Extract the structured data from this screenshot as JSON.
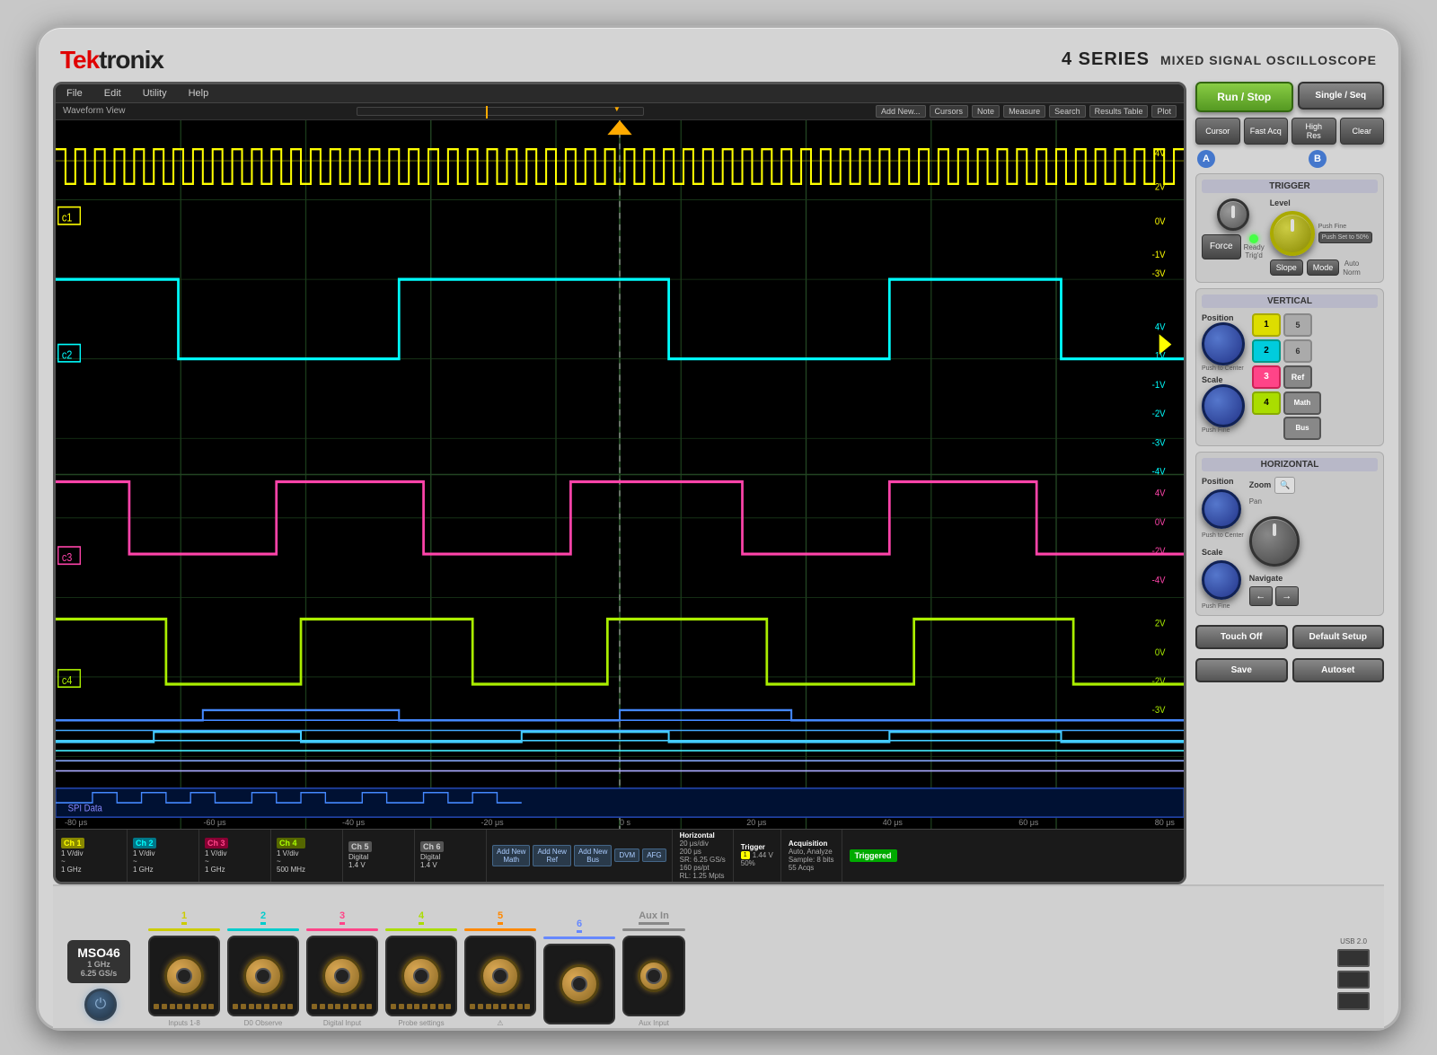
{
  "brand": {
    "name_tek": "Tek",
    "name_tronix": "tronix",
    "series": "4 SERIES",
    "subtitle": "MIXED SIGNAL OSCILLOSCOPE"
  },
  "menu": {
    "items": [
      "File",
      "Edit",
      "Utility",
      "Help"
    ]
  },
  "toolbar": {
    "waveform_view": "Waveform View",
    "add_new": "Add New...",
    "cursors": "Cursors",
    "note": "Note",
    "measure": "Measure",
    "search": "Search",
    "results_table": "Results Table",
    "plot": "Plot"
  },
  "controls": {
    "run_stop": "Run / Stop",
    "single_seq": "Single / Seq",
    "cursor": "Cursor",
    "fast_acq": "Fast Acq",
    "high_res": "High Res",
    "clear": "Clear"
  },
  "trigger": {
    "title": "TRIGGER",
    "force": "Force",
    "ready": "Ready",
    "trig_d": "Trig'd",
    "level_label": "Level",
    "set_50": "Push Set to 50%",
    "slope": "Slope",
    "mode": "Mode",
    "auto": "Auto",
    "norm": "Norm"
  },
  "vertical": {
    "title": "VERTICAL",
    "position_label": "Position",
    "push_to_center": "Push to Center",
    "scale_label": "Scale",
    "push_fine": "Push Fine",
    "ch1": "1",
    "ch2": "2",
    "ch3": "3",
    "ch4": "4",
    "ch5": "5",
    "ch6": "6",
    "ref": "Ref",
    "math": "Math",
    "bus": "Bus"
  },
  "horizontal": {
    "title": "HORIZONTAL",
    "position_label": "Position",
    "zoom_label": "Zoom",
    "pan_label": "Pan",
    "scale_label": "Scale",
    "navigate_label": "Navigate",
    "push_to_center": "Push to Center",
    "push_fine": "Push Fine"
  },
  "bottom_controls": {
    "touch_off": "Touch Off",
    "default_setup": "Default Setup",
    "save": "Save",
    "autoset": "Autoset"
  },
  "status_bar": {
    "ch1_label": "Ch 1",
    "ch1_val1": "1 V/div",
    "ch1_val2": "~",
    "ch1_val3": "1 GHz",
    "ch2_label": "Ch 2",
    "ch2_val1": "1 V/div",
    "ch2_val2": "~",
    "ch2_val3": "1 GHz",
    "ch3_label": "Ch 3",
    "ch3_val1": "1 V/div",
    "ch3_val2": "~",
    "ch3_val3": "1 GHz",
    "ch4_label": "Ch 4",
    "ch4_val1": "1 V/div",
    "ch4_val2": "~",
    "ch4_val3": "500 MHz",
    "ch5_label": "Ch 5",
    "ch5_val1": "Digital",
    "ch5_val2": "1.4 V",
    "ch6_label": "Ch 6",
    "ch6_val1": "Digital",
    "ch6_val2": "1.4 V",
    "add_math": "Add New Math",
    "add_ref": "Add New Ref",
    "add_bus": "Add New Bus",
    "dvm": "DVM",
    "afg": "AFG",
    "horiz_title": "Horizontal",
    "horiz_val1": "20 μs/div",
    "horiz_val2": "200 μs",
    "horiz_val3": "SR: 6.25 GS/s",
    "horiz_val4": "160 ps/pt",
    "horiz_val5": "RL: 1.25 Mpts",
    "trigger_title": "Trigger",
    "trigger_ch": "1",
    "trigger_val": "1.44 V",
    "trigger_pct": "50%",
    "acq_title": "Acquisition",
    "acq_val1": "Auto, Analyze",
    "acq_val2": "Sample: 8 bits",
    "acq_val3": "55 Acqs",
    "triggered": "Triggered"
  },
  "connectors": {
    "model": "MSO46",
    "spec1": "1 GHz",
    "spec2": "6.25 GS/s",
    "channels": [
      {
        "num": "1",
        "color": "#cccc00"
      },
      {
        "num": "2",
        "color": "#00cccc"
      },
      {
        "num": "3",
        "color": "#ff4488"
      },
      {
        "num": "4",
        "color": "#aadd00"
      },
      {
        "num": "5",
        "color": "#ff8800"
      },
      {
        "num": "6",
        "color": "#6688ff"
      }
    ],
    "aux_in": "Aux In",
    "usb": "USB 2.0"
  },
  "timescale": {
    "labels": [
      "-80 μs",
      "-60 μs",
      "-40 μs",
      "-20 μs",
      "0 s",
      "20 μs",
      "40 μs",
      "60 μs",
      "80 μs"
    ]
  }
}
